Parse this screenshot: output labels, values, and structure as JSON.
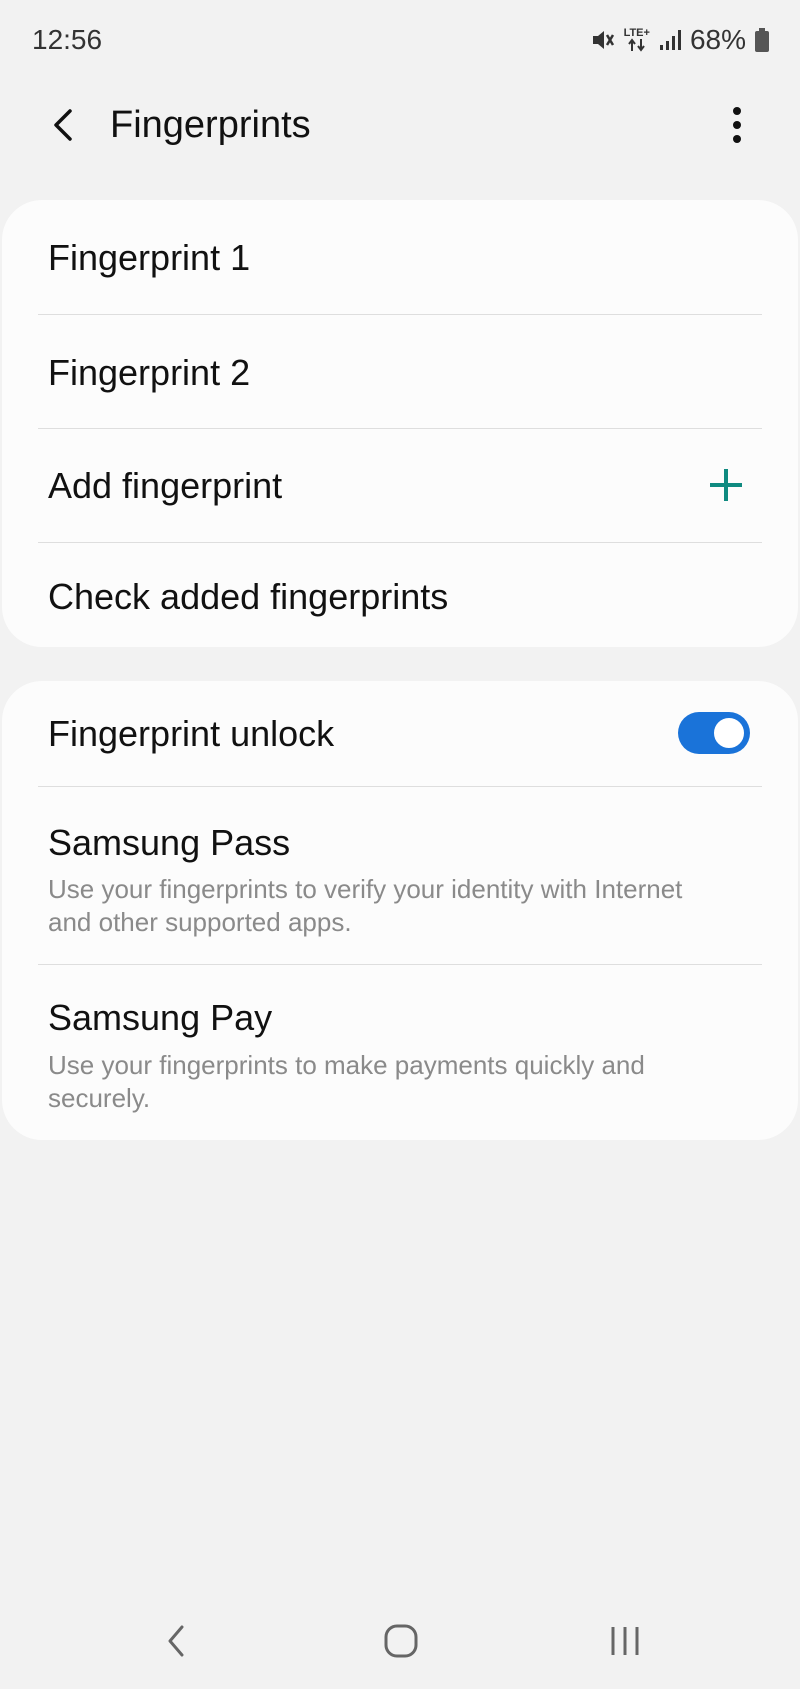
{
  "status_bar": {
    "time": "12:56",
    "network": "LTE+",
    "battery_percent": "68%"
  },
  "app_bar": {
    "title": "Fingerprints",
    "back_icon": "chevron-left-icon",
    "more_icon": "more-vertical-icon"
  },
  "fingerprint_list": {
    "items": [
      {
        "title": "Fingerprint 1"
      },
      {
        "title": "Fingerprint 2"
      },
      {
        "title": "Add fingerprint",
        "icon": "plus-icon"
      },
      {
        "title": "Check added fingerprints"
      }
    ]
  },
  "settings": {
    "unlock": {
      "title": "Fingerprint unlock",
      "enabled": true
    },
    "samsung_pass": {
      "title": "Samsung Pass",
      "subtitle": "Use your fingerprints to verify your identity with Internet and other supported apps."
    },
    "samsung_pay": {
      "title": "Samsung Pay",
      "subtitle": "Use your fingerprints to make payments quickly and securely."
    }
  },
  "colors": {
    "accent": "#0f8a80",
    "toggle_on": "#1a73d9",
    "background": "#f2f2f2",
    "card": "#fcfcfc"
  }
}
